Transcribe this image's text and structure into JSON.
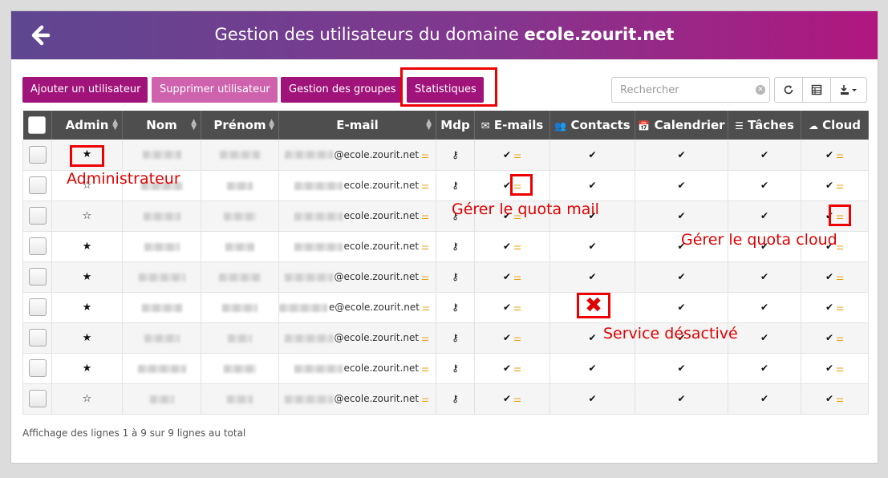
{
  "header": {
    "title_prefix": "Gestion des utilisateurs du domaine ",
    "title_domain": "ecole.zourit.net",
    "gradient": [
      "#5e4690",
      "#b0177f"
    ]
  },
  "toolbar": {
    "add_label": "Ajouter un utilisateur",
    "delete_label": "Supprimer utilisateur",
    "groups_label": "Gestion des groupes",
    "stats_label": "Statistiques",
    "search_placeholder": "Rechercher"
  },
  "columns": {
    "admin": "Admin",
    "nom": "Nom",
    "prenom": "Prénom",
    "email": "E-mail",
    "mdp": "Mdp",
    "emails": "E-mails",
    "contacts": "Contacts",
    "calendrier": "Calendrier",
    "taches": "Tâches",
    "cloud": "Cloud"
  },
  "rows": [
    {
      "admin": "★",
      "email": "@ecole.zourit.net"
    },
    {
      "admin": "☆",
      "email": "ecole.zourit.net"
    },
    {
      "admin": "☆",
      "email": "ecole.zourit.net"
    },
    {
      "admin": "★",
      "email": "ecole.zourit.net"
    },
    {
      "admin": "★",
      "email": "@ecole.zourit.net"
    },
    {
      "admin": "★",
      "email": "e@ecole.zourit.net"
    },
    {
      "admin": "★",
      "email": "@ecole.zourit.net"
    },
    {
      "admin": "★",
      "email": "ecole.zourit.net"
    },
    {
      "admin": "☆",
      "email": "@ecole.zourit.net"
    }
  ],
  "footer": "Affichage des lignes 1 à 9 sur 9 lignes au total",
  "annotations": {
    "admin": "Administrateur",
    "quota_mail": "Gérer le quota mail",
    "quota_cloud": "Gérer le quota cloud",
    "service_off": "Service désactivé"
  },
  "icons": {
    "back": "arrow-left-icon",
    "key": "key-icon",
    "check": "check-icon",
    "sliders": "sliders-icon",
    "star": "star-icon"
  },
  "colors": {
    "primary": "#a0137a",
    "secondary": "#cf62ad",
    "annotation": "#ee0000",
    "quota": "#e8a317"
  }
}
